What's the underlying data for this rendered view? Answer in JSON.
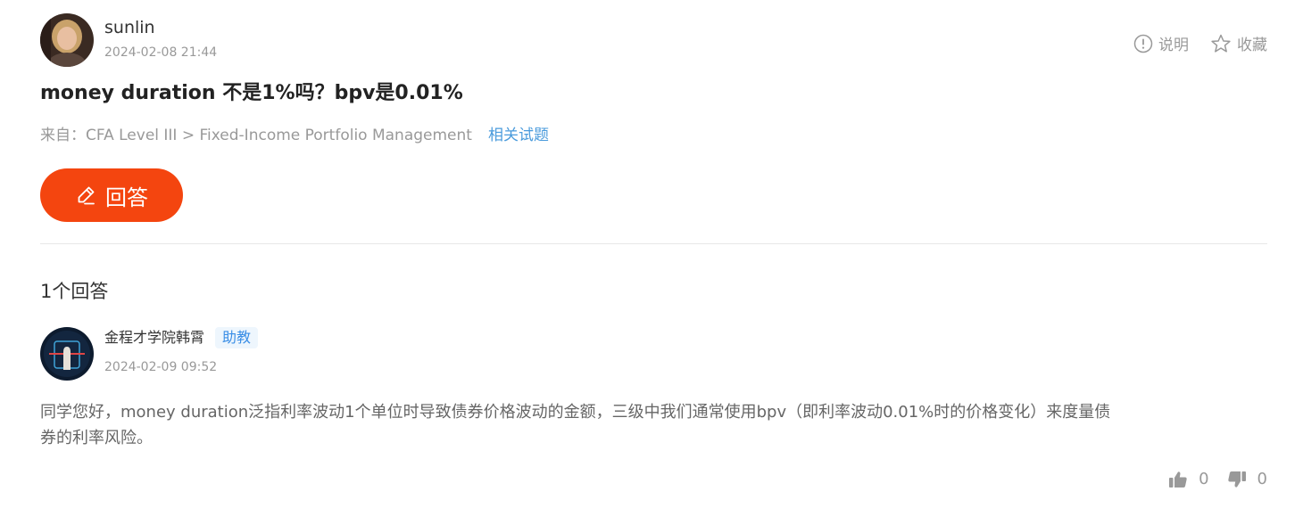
{
  "question": {
    "user": {
      "name": "sunlin",
      "time": "2024-02-08 21:44"
    },
    "actions": {
      "explain_label": "说明",
      "favorite_label": "收藏"
    },
    "title": "money duration 不是1%吗？bpv是0.01%",
    "source": {
      "prefix": "来自：",
      "path": "CFA Level III > Fixed-Income Portfolio Management",
      "related_label": "相关试题"
    },
    "answer_button_label": "回答"
  },
  "answers": {
    "count_label": "1个回答",
    "items": [
      {
        "name": "金程才学院韩霄",
        "badge": "助教",
        "time": "2024-02-09 09:52",
        "content": "同学您好，money duration泛指利率波动1个单位时导致债券价格波动的金额，三级中我们通常使用bpv（即利率波动0.01%时的价格变化）来度量债券的利率风险。",
        "likes": "0",
        "dislikes": "0"
      }
    ]
  },
  "icons": {
    "explain": "info-circle-icon",
    "favorite": "star-outline-icon",
    "answer": "pencil-icon",
    "like": "thumbs-up-icon",
    "dislike": "thumbs-down-icon"
  },
  "colors": {
    "accent": "#f4450f",
    "link": "#4a9bdc",
    "badge_text": "#3a8ee6",
    "badge_bg": "#eef6fd",
    "muted": "#999999"
  }
}
